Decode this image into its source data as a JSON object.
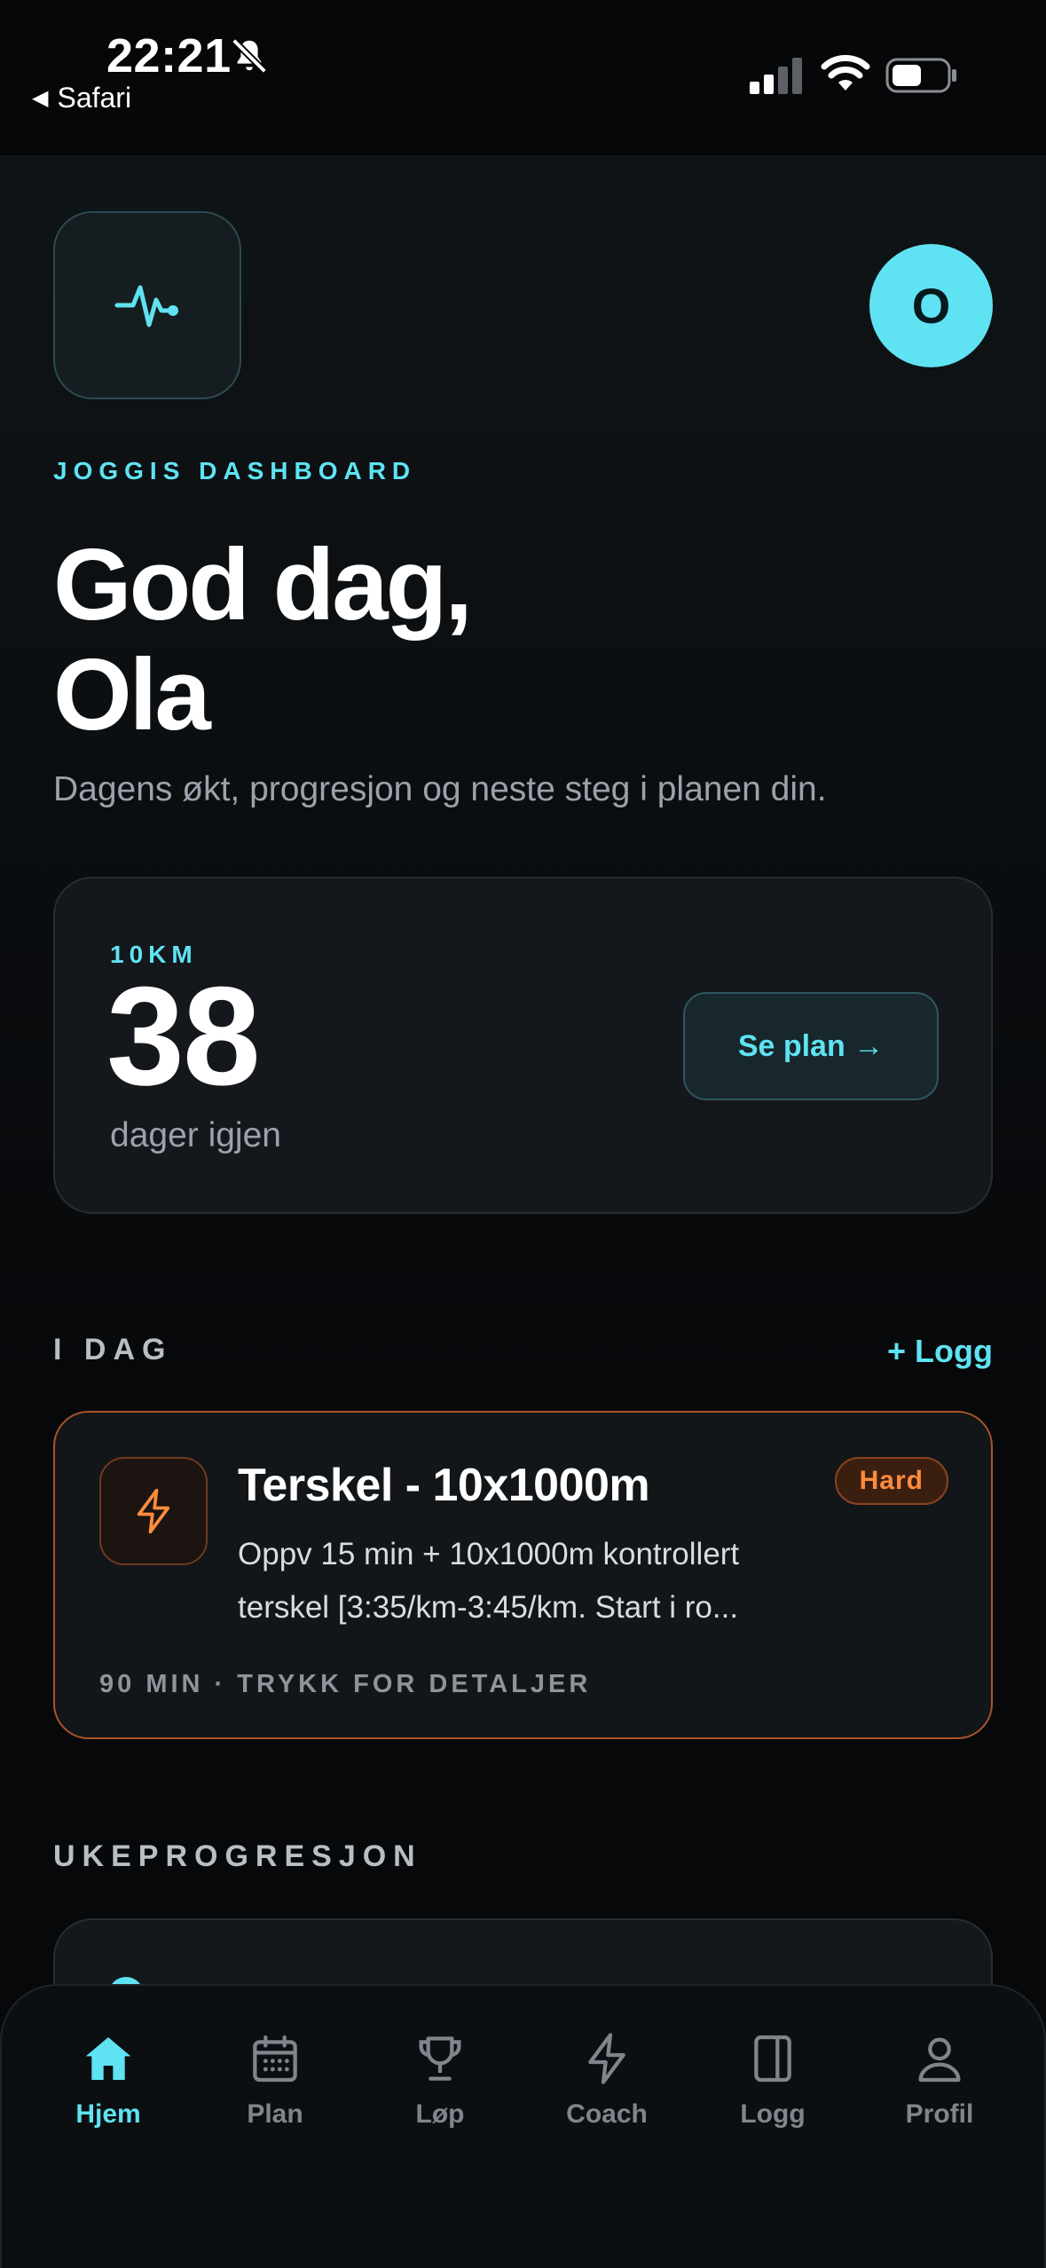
{
  "status_bar": {
    "time": "22:21",
    "back_label": "Safari"
  },
  "header": {
    "avatar_initial": "O",
    "eyebrow": "JOGGIS DASHBOARD",
    "greeting_line1": "God dag,",
    "greeting_line2": "Ola",
    "subtitle": "Dagens økt, progresjon og neste steg i planen din."
  },
  "countdown": {
    "label": "10KM",
    "days": "38",
    "caption": "dager igjen",
    "button_label": "Se plan →"
  },
  "today": {
    "section_title": "I DAG",
    "log_link": "+ Logg",
    "workout": {
      "title": "Terskel - 10x1000m",
      "intensity": "Hard",
      "description_line1": "Oppv 15 min + 10x1000m kontrollert",
      "description_line2": "terskel [3:35/km-3:45/km. Start i ro...",
      "meta": "90 MIN · TRYKK FOR DETALJER"
    }
  },
  "progression": {
    "section_title": "UKEPROGRESJON"
  },
  "tabbar": {
    "tabs": [
      {
        "label": "Hjem",
        "icon": "home-icon",
        "active": true
      },
      {
        "label": "Plan",
        "icon": "calendar-icon",
        "active": false
      },
      {
        "label": "Løp",
        "icon": "trophy-icon",
        "active": false
      },
      {
        "label": "Coach",
        "icon": "lightning-icon",
        "active": false
      },
      {
        "label": "Logg",
        "icon": "journal-icon",
        "active": false
      },
      {
        "label": "Profil",
        "icon": "person-icon",
        "active": false
      }
    ]
  },
  "colors": {
    "accent": "#5fe3f2",
    "hard": "#ff8b3d",
    "background": "#0a0c0f"
  }
}
